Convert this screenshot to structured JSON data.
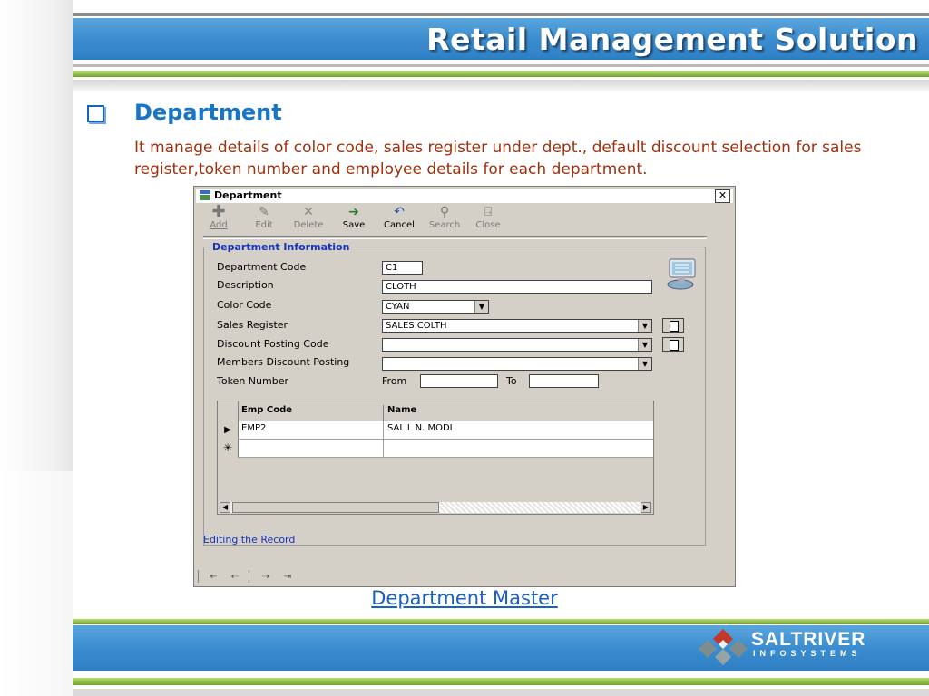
{
  "header": {
    "title": "Retail Management Solution"
  },
  "section": {
    "heading": "Department",
    "description": "It manage details of color code, sales register under dept., default discount selection for sales register,token number and employee details for each department."
  },
  "window": {
    "title": "Department",
    "toolbar": [
      {
        "icon": "add-icon",
        "label": "Add",
        "enabled": false
      },
      {
        "icon": "edit-icon",
        "label": "Edit",
        "enabled": false
      },
      {
        "icon": "delete-icon",
        "label": "Delete",
        "enabled": false
      },
      {
        "icon": "save-icon",
        "label": "Save",
        "enabled": true
      },
      {
        "icon": "cancel-icon",
        "label": "Cancel",
        "enabled": true
      },
      {
        "icon": "search-icon",
        "label": "Search",
        "enabled": false
      },
      {
        "icon": "close-icon",
        "label": "Close",
        "enabled": false
      }
    ],
    "group_title": "Department Information",
    "fields": {
      "department_code": {
        "label": "Department Code",
        "value": "C1"
      },
      "description": {
        "label": "Description",
        "value": "CLOTH"
      },
      "color_code": {
        "label": "Color Code",
        "value": "CYAN"
      },
      "sales_register": {
        "label": "Sales Register",
        "value": "SALES COLTH"
      },
      "discount_posting_code": {
        "label": "Discount Posting Code",
        "value": ""
      },
      "members_discount_posting": {
        "label": "Members Discount Posting",
        "value": ""
      },
      "token_number": {
        "label": "Token Number",
        "from_label": "From",
        "from_value": "",
        "to_label": "To",
        "to_value": ""
      }
    },
    "grid": {
      "columns": [
        "Emp Code",
        "Name"
      ],
      "rows": [
        {
          "emp_code": "EMP2",
          "name": "SALIL N. MODI"
        }
      ]
    },
    "status": "Editing the Record"
  },
  "caption": "Department Master",
  "footer": {
    "logo_name": "SALTRIVER",
    "logo_sub": "INFOSYSTEMS"
  },
  "colors": {
    "header_blue": "#3b8dcf",
    "accent_green": "#8bc53f",
    "heading_blue": "#1776c8",
    "desc_text": "#a0300d",
    "status_blue": "#1533b8"
  }
}
